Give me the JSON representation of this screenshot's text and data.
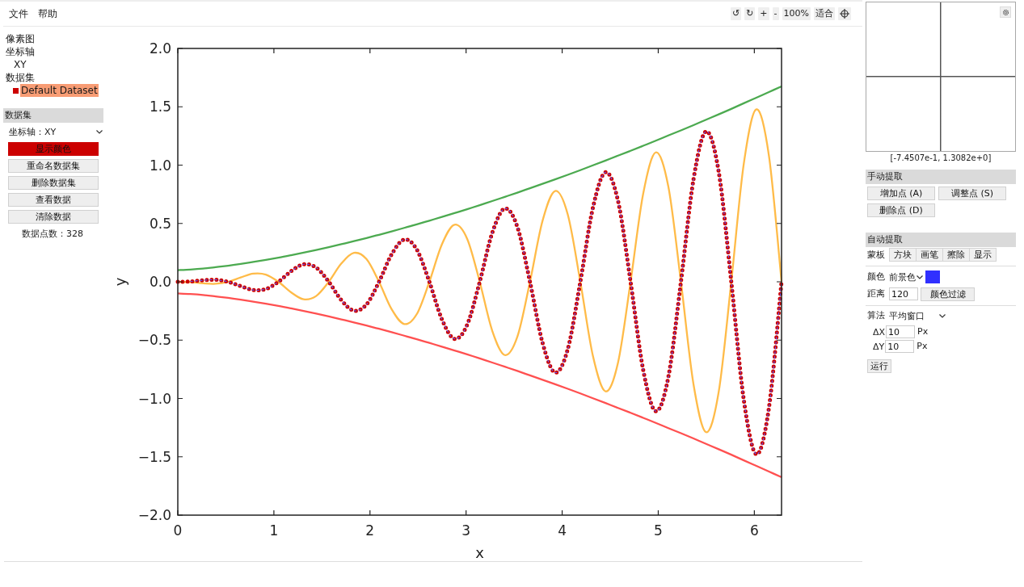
{
  "menu": [
    "文件",
    "帮助"
  ],
  "toolbar": {
    "buttons": [
      "↺",
      "↻",
      "+",
      "-",
      "100%",
      "适合"
    ]
  },
  "tree": [
    {
      "label": "像素图",
      "selected": false
    },
    {
      "label": "坐标轴",
      "selected": false,
      "children": [
        {
          "label": "XY",
          "selected": false
        }
      ]
    },
    {
      "label": "数据集",
      "selected": false,
      "children": [
        {
          "label": "Default Dataset",
          "selected": true,
          "color": "#cc0000"
        }
      ]
    }
  ],
  "dataset_panel": {
    "title": "数据集",
    "axes_label": "坐标轴：",
    "axes_value": "XY",
    "buttons": [
      {
        "label": "显示颜色",
        "kind": "color",
        "color": "#cc0000"
      },
      {
        "label": "重命名数据集",
        "kind": "plain"
      },
      {
        "label": "删除数据集",
        "kind": "plain"
      },
      {
        "label": "查看数据",
        "kind": "plain"
      },
      {
        "label": "清除数据",
        "kind": "plain"
      }
    ],
    "point_count": "数据点数：328"
  },
  "plot": {
    "chart_data": {
      "type": "line",
      "xlabel": "x",
      "ylabel": "y",
      "x": [
        0,
        0.131,
        0.262,
        0.393,
        0.524,
        0.654,
        0.785,
        0.916,
        1.047,
        1.178,
        1.309,
        1.44,
        1.571,
        1.702,
        1.833,
        1.963,
        2.094,
        2.225,
        2.356,
        2.487,
        2.618,
        2.749,
        2.88,
        3.011,
        3.142,
        3.272,
        3.403,
        3.534,
        3.665,
        3.796,
        3.927,
        4.058,
        4.189,
        4.32,
        4.451,
        4.581,
        4.712,
        4.843,
        4.974,
        5.105,
        5.236,
        5.367,
        5.498,
        5.629,
        5.76,
        5.89,
        6.021,
        6.152,
        6.283
      ],
      "series": [
        {
          "color": "#4caa50",
          "line_style": "solid",
          "values": [
            0.1,
            0.105,
            0.113,
            0.125,
            0.138,
            0.153,
            0.17,
            0.188,
            0.207,
            0.228,
            0.25,
            0.273,
            0.297,
            0.322,
            0.348,
            0.375,
            0.403,
            0.432,
            0.462,
            0.492,
            0.524,
            0.556,
            0.589,
            0.622,
            0.657,
            0.692,
            0.728,
            0.764,
            0.802,
            0.84,
            0.878,
            0.917,
            0.957,
            0.998,
            1.039,
            1.081,
            1.123,
            1.166,
            1.209,
            1.254,
            1.298,
            1.343,
            1.389,
            1.435,
            1.482,
            1.53,
            1.578,
            1.626,
            1.675
          ]
        },
        {
          "color": "#ff5050",
          "line_style": "solid",
          "values": [
            -0.1,
            -0.105,
            -0.113,
            -0.125,
            -0.138,
            -0.153,
            -0.17,
            -0.188,
            -0.207,
            -0.228,
            -0.25,
            -0.273,
            -0.297,
            -0.322,
            -0.348,
            -0.375,
            -0.403,
            -0.432,
            -0.462,
            -0.492,
            -0.524,
            -0.556,
            -0.589,
            -0.622,
            -0.657,
            -0.692,
            -0.728,
            -0.764,
            -0.802,
            -0.84,
            -0.878,
            -0.917,
            -0.957,
            -0.998,
            -1.039,
            -1.081,
            -1.123,
            -1.166,
            -1.209,
            -1.254,
            -1.298,
            -1.343,
            -1.389,
            -1.435,
            -1.482,
            -1.53,
            -1.578,
            -1.626,
            -1.675
          ]
        },
        {
          "color": "#ffbb48",
          "line_style": "solid",
          "values": [
            0,
            -0.003,
            -0.013,
            -0.017,
            0,
            0.037,
            0.07,
            0.062,
            0,
            -0.09,
            -0.15,
            -0.122,
            0,
            0.157,
            0.248,
            0.195,
            0,
            -0.235,
            -0.362,
            -0.277,
            0,
            0.322,
            0.489,
            0.369,
            0,
            -0.419,
            -0.628,
            -0.47,
            0,
            0.523,
            0.778,
            0.578,
            0,
            -0.635,
            -0.939,
            -0.694,
            0,
            0.754,
            1.109,
            0.816,
            0,
            -0.879,
            -1.289,
            -0.944,
            0,
            1.011,
            1.478,
            1.079,
            0
          ]
        },
        {
          "color": "#cc0000",
          "line_style": "dotted",
          "values": [
            0,
            0.003,
            0.013,
            0.017,
            0,
            -0.037,
            -0.07,
            -0.062,
            0,
            0.09,
            0.15,
            0.122,
            0,
            -0.157,
            -0.248,
            -0.195,
            0,
            0.235,
            0.362,
            0.277,
            0,
            -0.322,
            -0.489,
            -0.369,
            0,
            0.419,
            0.628,
            0.47,
            0,
            -0.523,
            -0.778,
            -0.578,
            0,
            0.635,
            0.939,
            0.694,
            0,
            -0.754,
            -1.109,
            -0.816,
            0,
            0.879,
            1.289,
            0.944,
            0,
            -1.011,
            -1.478,
            -1.079,
            0
          ]
        },
        {
          "color": "#5a5aff",
          "line_style": "dashed",
          "values": [
            null,
            0.003,
            0.013,
            0.017,
            0,
            -0.037,
            -0.07,
            -0.062,
            0,
            0.09,
            0.15,
            0.122,
            0,
            -0.157,
            -0.248,
            -0.195,
            0,
            0.235,
            0.362,
            0.277,
            0,
            -0.322,
            -0.489,
            -0.369,
            0,
            0.419,
            0.628,
            0.47,
            0,
            -0.523,
            -0.778,
            -0.578,
            0,
            0.635,
            0.939,
            0.694,
            0,
            -0.754,
            -1.109,
            -0.816,
            0,
            0.879,
            1.289,
            0.944,
            0,
            -1.011,
            -1.478,
            -1.079,
            0
          ]
        }
      ],
      "xlim": [
        0,
        6.283
      ],
      "ylim": [
        -2,
        2
      ],
      "xticks": [
        0,
        1,
        2,
        3,
        4,
        5,
        6
      ],
      "yticks": [
        {
          "value": -2,
          "label": "−2.0"
        },
        {
          "value": -1.5,
          "label": "−1.5"
        },
        {
          "value": -1,
          "label": "−1.0"
        },
        {
          "value": -0.5,
          "label": "−0.5"
        },
        {
          "value": 0,
          "label": "0.0"
        },
        {
          "value": 0.5,
          "label": "0.5"
        },
        {
          "value": 1,
          "label": "1.0"
        },
        {
          "value": 1.5,
          "label": "1.5"
        },
        {
          "value": 2,
          "label": "2.0"
        }
      ]
    }
  },
  "magnifier": {
    "coordinates": "[-7.4507e-1, 1.3082e+0]"
  },
  "manual_extraction": {
    "title": "手动提取",
    "buttons": [
      "增加点 (A)",
      "调整点 (S)",
      "删除点 (D)"
    ]
  },
  "auto_extraction": {
    "title": "自动提取",
    "mask": {
      "label": "蒙板",
      "buttons": [
        "方块",
        "画笔",
        "擦除",
        "显示"
      ]
    },
    "color": {
      "label": "颜色",
      "mode": "前景色",
      "color": "#3030ff"
    },
    "distance": {
      "label": "距离",
      "value": "120",
      "button": "颜色过滤"
    },
    "algorithm": {
      "label": "算法",
      "value": "平均窗口"
    },
    "params": [
      {
        "label": "ΔX",
        "value": "10",
        "unit": "Px"
      },
      {
        "label": "ΔY",
        "value": "10",
        "unit": "Px"
      }
    ],
    "run_button": "运行"
  }
}
